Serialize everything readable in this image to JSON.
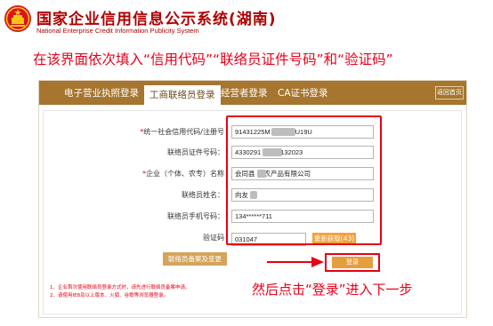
{
  "header": {
    "title": "国家企业信用信息公示系统(湖南)",
    "subtitle": "National Enterprise Credit Information Publicity System",
    "emblem_icon": "national-emblem"
  },
  "instruction": "在该界面依次填入“信用代码”“联络员证件号码”和“验证码”",
  "tabs": [
    {
      "label": "电子营业执照登录",
      "active": false
    },
    {
      "label": "工商联络员登录",
      "active": true
    },
    {
      "label": "经营者登录",
      "active": false
    },
    {
      "label": "CA证书登录",
      "active": false
    }
  ],
  "back_button": "返回首页",
  "form": {
    "credit_code": {
      "required_mark": "*",
      "label": "统一社会信用代码/注册号",
      "value_prefix": "91431225M",
      "value_suffix": "U19U"
    },
    "id_number": {
      "label": "联络员证件号码：",
      "value_prefix": "4330291",
      "value_suffix": "132023"
    },
    "company_name": {
      "required_mark": "*",
      "label": "企业（个体、农专）名称",
      "value_prefix": "会同县",
      "value_suffix": "农产品有限公司"
    },
    "contact_name": {
      "label": "联络员姓名：",
      "value": "向友"
    },
    "contact_phone": {
      "label": "联络员手机号码：",
      "value": "134******711"
    },
    "captcha": {
      "label": "验证码",
      "value": "031047",
      "refresh_label": "重新获取(43)"
    }
  },
  "buttons": {
    "backup": "联络员备案及变更",
    "login": "登录"
  },
  "footnotes": [
    "1、企业首次使用联络员登录方式时，请先进行联络员备案申请。",
    "2、请使用IE8及以上版本、火狐、谷歌等浏览器登录。"
  ],
  "followup": "然后点击“登录”进入下一步",
  "colors": {
    "brand_red": "#b00000",
    "annotation_red": "#e60012",
    "tab_bar": "#a6752f",
    "button_orange": "#e59e3d"
  }
}
